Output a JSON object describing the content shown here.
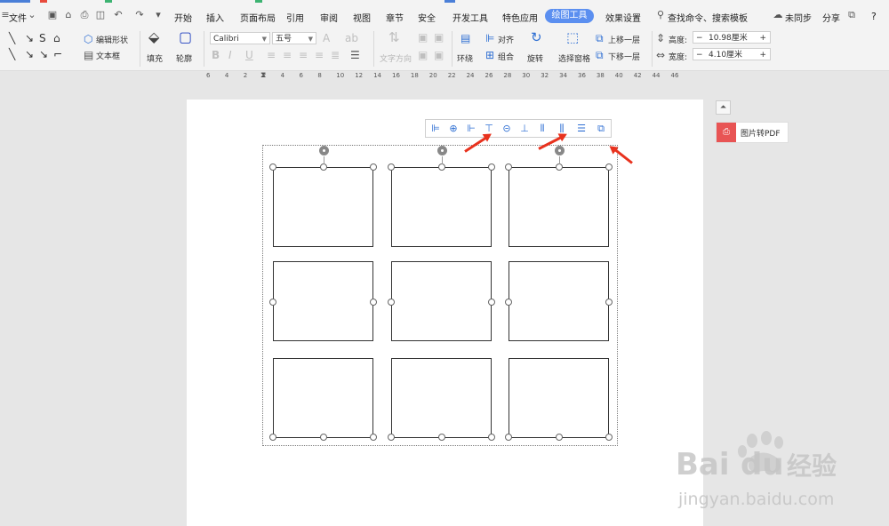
{
  "menu": {
    "file": "文件",
    "tabs": [
      "开始",
      "插入",
      "页面布局",
      "引用",
      "审阅",
      "视图",
      "章节",
      "安全",
      "开发工具",
      "特色应用",
      "绘图工具",
      "效果设置"
    ],
    "active_tab": "绘图工具",
    "search": "查找命令、搜索模板",
    "sync": "未同步",
    "share": "分享",
    "help": "?"
  },
  "ribbon": {
    "edit_shape": "编辑形状",
    "text_box": "文本框",
    "fill": "填充",
    "outline": "轮廓",
    "font_name": "Calibri",
    "font_size": "五号",
    "text_direction": "文字方向",
    "wrap": "环绕",
    "align": "对齐",
    "group": "组合",
    "rotate": "旋转",
    "select_pane": "选择窗格",
    "bring_forward": "上移一层",
    "send_backward": "下移一层",
    "height_label": "高度:",
    "height_value": "10.98厘米",
    "width_label": "宽度:",
    "width_value": "4.10厘米",
    "minus": "−",
    "plus": "+"
  },
  "ruler": {
    "ticks": [
      "6",
      "4",
      "2",
      "2",
      "4",
      "6",
      "8",
      "10",
      "12",
      "14",
      "16",
      "18",
      "20",
      "22",
      "24",
      "26",
      "28",
      "30",
      "32",
      "34",
      "36",
      "38",
      "40",
      "42",
      "44",
      "46"
    ]
  },
  "side": {
    "pdf_label": "图片转PDF",
    "collapse": "⏶"
  },
  "watermark": {
    "brand": "Bai",
    "brand2": "du",
    "cn": "经验",
    "url": "jingyan.baidu.com"
  },
  "colors": {
    "accent": "#5b8ff0",
    "arrow": "#e8321e",
    "pdf": "#e85454"
  }
}
